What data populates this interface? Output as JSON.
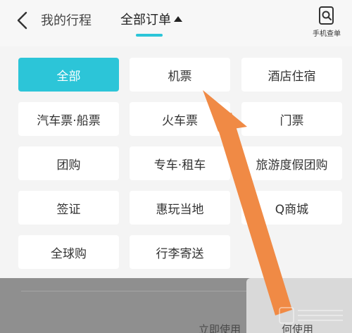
{
  "header": {
    "back_label": "<",
    "trip_tab": "我的行程",
    "all_orders_tab": "全部订单",
    "phone_query": "手机查单"
  },
  "categories": [
    {
      "label": "全部",
      "active": true
    },
    {
      "label": "机票",
      "active": false
    },
    {
      "label": "酒店住宿",
      "active": false
    },
    {
      "label": "汽车票·船票",
      "active": false
    },
    {
      "label": "火车票",
      "active": false
    },
    {
      "label": "门票",
      "active": false
    },
    {
      "label": "团购",
      "active": false
    },
    {
      "label": "专车·租车",
      "active": false
    },
    {
      "label": "旅游度假团购",
      "active": false
    },
    {
      "label": "签证",
      "active": false
    },
    {
      "label": "惠玩当地",
      "active": false
    },
    {
      "label": "Q商城",
      "active": false
    },
    {
      "label": "全球购",
      "active": false
    },
    {
      "label": "行李寄送",
      "active": false
    }
  ],
  "background": {
    "link1": "立即使用",
    "link2": "何使用"
  },
  "colors": {
    "accent": "#2cc5d8",
    "arrow": "#f08a45"
  }
}
